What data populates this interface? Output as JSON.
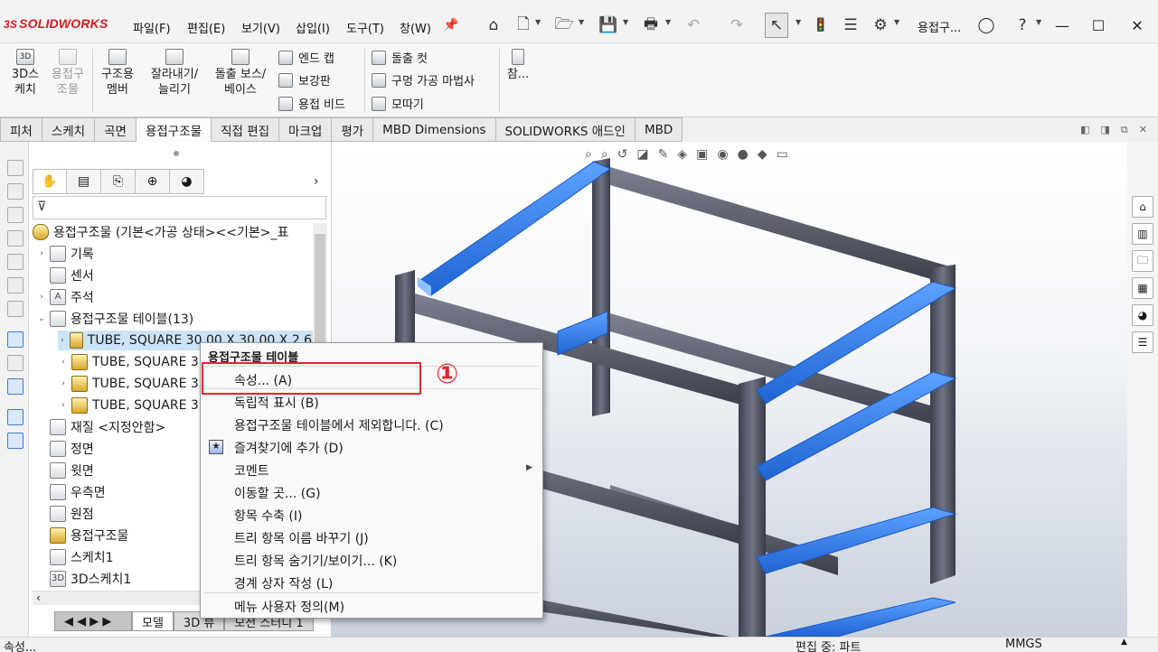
{
  "app": {
    "logo": "SOLIDWORKS",
    "logo_mark": "3S",
    "doc_title": "용접구..."
  },
  "menu": [
    "파일(F)",
    "편집(E)",
    "보기(V)",
    "삽입(I)",
    "도구(T)",
    "창(W)"
  ],
  "ribbon": {
    "big": [
      {
        "label": "3D스\n케치",
        "icon": "3D"
      },
      {
        "label": "용접구\n조물",
        "icon": "",
        "disabled": true
      },
      {
        "label": "구조용\n멤버",
        "icon": ""
      },
      {
        "label": "잘라내기/\n늘리기",
        "icon": ""
      },
      {
        "label": "돌출 보스/\n베이스",
        "icon": ""
      }
    ],
    "col1": [
      "엔드 캡",
      "보강판",
      "용접 비드"
    ],
    "col2": [
      "돌출 컷",
      "구멍 가공 마법사",
      "모따기"
    ],
    "last": "참..."
  },
  "tabs": [
    "피처",
    "스케치",
    "곡면",
    "용접구조물",
    "직접 편집",
    "마크업",
    "평가",
    "MBD Dimensions",
    "SOLIDWORKS 애드인",
    "MBD"
  ],
  "active_tab": "용접구조물",
  "tree": {
    "root": "용접구조물  (기본<가공 상태><<기본>_표",
    "items": [
      {
        "label": "기록",
        "arrow": "›",
        "icon": "history-icon"
      },
      {
        "label": "센서",
        "arrow": "",
        "icon": "sensor-icon"
      },
      {
        "label": "주석",
        "arrow": "›",
        "icon": "annotation-icon"
      },
      {
        "label": "용접구조물 테이블(13)",
        "arrow": "⌄",
        "icon": "cutlist-icon"
      },
      {
        "label": "TUBE, SQUARE 30.00 X 30.00 X 2.60",
        "arrow": "›",
        "icon": "cutlist-item-icon",
        "selected": true
      },
      {
        "label": "TUBE, SQUARE 3",
        "arrow": "›",
        "icon": "cutlist-item-icon"
      },
      {
        "label": "TUBE, SQUARE 3",
        "arrow": "›",
        "icon": "cutlist-item-icon"
      },
      {
        "label": "TUBE, SQUARE 3",
        "arrow": "›",
        "icon": "cutlist-item-icon"
      },
      {
        "label": "재질 <지정안함>",
        "arrow": "",
        "icon": "material-icon"
      },
      {
        "label": "정면",
        "arrow": "",
        "icon": "plane-icon"
      },
      {
        "label": "윗면",
        "arrow": "",
        "icon": "plane-icon"
      },
      {
        "label": "우측면",
        "arrow": "",
        "icon": "plane-icon"
      },
      {
        "label": "원점",
        "arrow": "",
        "icon": "origin-icon"
      },
      {
        "label": "용접구조물",
        "arrow": "",
        "icon": "weldment-icon"
      },
      {
        "label": "스케치1",
        "arrow": "",
        "icon": "sketch-icon"
      },
      {
        "label": "3D스케치1",
        "arrow": "",
        "icon": "3dsketch-icon"
      }
    ]
  },
  "bottom_tabs": [
    "모델",
    "3D 뷰",
    "모션 스터디 1"
  ],
  "context_menu": {
    "header": "용접구조물 테이블",
    "items": [
      "속성... (A)",
      "독립적 표시 (B)",
      "용접구조물 테이블에서 제외합니다. (C)",
      "즐겨찾기에 추가 (D)",
      "코멘트",
      "이동할 곳... (G)",
      "항목 수축 (I)",
      "트리 항목 이름 바꾸기 (J)",
      "트리 항목 숨기기/보이기... (K)",
      "경계 상자 작성 (L)",
      "메뉴 사용자 정의(M)"
    ]
  },
  "step_marker": "①",
  "status": {
    "left": "속성...",
    "mode": "편집 중: 파트",
    "units": "MMGS"
  },
  "colors": {
    "accent": "#e3262d",
    "selection": "#2f7fe6",
    "frame": "#5b5f6c"
  }
}
